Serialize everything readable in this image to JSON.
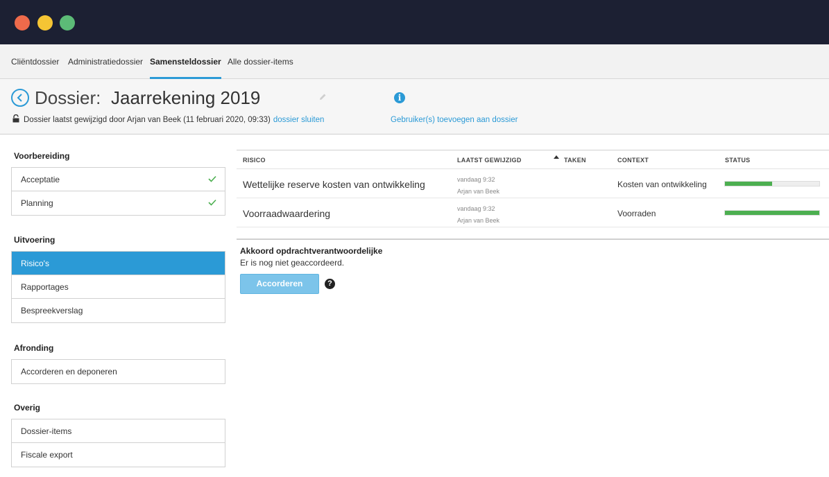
{
  "window": {
    "colors": {
      "titlebar": "#1c2033",
      "accent": "#2b9ad6",
      "progress": "#4caf50"
    }
  },
  "tabs": [
    {
      "label": "Cliëntdossier"
    },
    {
      "label": "Administratiedossier"
    },
    {
      "label": "Samensteldossier",
      "active": true
    },
    {
      "label": "Alle dossier-items"
    }
  ],
  "header": {
    "dossier_label": "Dossier:",
    "dossier_name": "Jaarrekening 2019",
    "last_modified": "Dossier laatst gewijzigd door Arjan van Beek (11 februari 2020, 09:33)",
    "close_link": "dossier sluiten",
    "add_users_link": "Gebruiker(s) toevoegen aan dossier",
    "icons": [
      "back-icon",
      "pencil-icon",
      "info-icon",
      "lock-icon"
    ]
  },
  "sidebar": {
    "sections": [
      {
        "title": "Voorbereiding",
        "items": [
          {
            "label": "Acceptatie",
            "done": true
          },
          {
            "label": "Planning",
            "done": true
          }
        ]
      },
      {
        "title": "Uitvoering",
        "items": [
          {
            "label": "Risico's",
            "active": true
          },
          {
            "label": "Rapportages"
          },
          {
            "label": "Bespreekverslag"
          }
        ]
      },
      {
        "title": "Afronding",
        "items": [
          {
            "label": "Accorderen en deponeren"
          }
        ]
      },
      {
        "title": "Overig",
        "items": [
          {
            "label": "Dossier-items"
          },
          {
            "label": "Fiscale export"
          }
        ]
      }
    ]
  },
  "table": {
    "columns": {
      "risico": "RISICO",
      "laatst_gewijzigd": "LAATST GEWIJZIGD",
      "taken": "TAKEN",
      "context": "CONTEXT",
      "status": "STATUS"
    },
    "sort_column": "taken",
    "rows": [
      {
        "risico": "Wettelijke reserve kosten van ontwikkeling",
        "modified_time": "vandaag 9:32",
        "modified_by": "Arjan van Beek",
        "taken": "",
        "context": "Kosten van ontwikkeling",
        "status_progress": 0.5
      },
      {
        "risico": "Voorraadwaardering",
        "modified_time": "vandaag 9:32",
        "modified_by": "Arjan van Beek",
        "taken": "",
        "context": "Voorraden",
        "status_progress": 1.0
      }
    ]
  },
  "approval": {
    "title": "Akkoord opdrachtverantwoordelijke",
    "status": "Er is nog niet geaccordeerd.",
    "button_label": "Accorderen",
    "help_glyph": "?"
  }
}
